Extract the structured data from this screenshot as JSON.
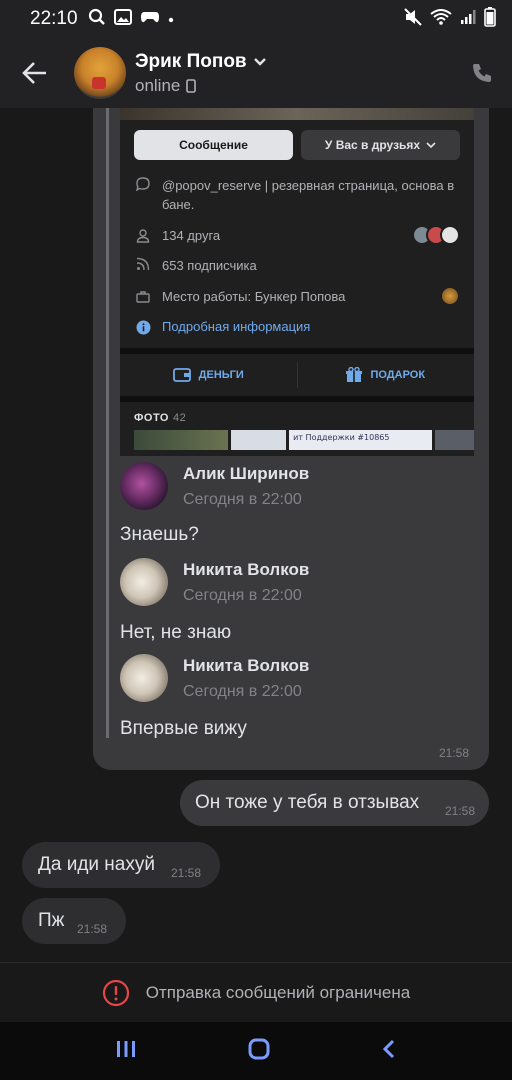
{
  "status_bar": {
    "time": "22:10"
  },
  "header": {
    "name": "Эрик Попов",
    "status": "online"
  },
  "profile_card": {
    "message_button": "Сообщение",
    "friends_button": "У Вас в друзьях",
    "status_line": "@popov_reserve | резервная страница, основа в бане.",
    "friends_count": "134 друга",
    "followers_count": "653 подписчика",
    "workplace": "Место работы: Бункер Попова",
    "details_link": "Подробная информация",
    "money_label": "ДЕНЬГИ",
    "gift_label": "ПОДАРОК",
    "photos_label": "ФОТО",
    "photos_count": "42",
    "photo_caption": "ит Поддержки #10865"
  },
  "forwarded_messages": [
    {
      "author": "Алик Ширинов",
      "time": "Сегодня в 22:00",
      "text": "Знаешь?"
    },
    {
      "author": "Никита Волков",
      "time": "Сегодня в 22:00",
      "text": "Нет, не знаю"
    },
    {
      "author": "Никита Волков",
      "time": "Сегодня в 22:00",
      "text": "Впервые вижу"
    }
  ],
  "forward_time": "21:58",
  "messages": [
    {
      "text": "Он тоже у тебя в отзывах",
      "time": "21:58",
      "direction": "out"
    },
    {
      "text": "Да иди нахуй",
      "time": "21:58",
      "direction": "in"
    },
    {
      "text": "Пж",
      "time": "21:58",
      "direction": "in"
    }
  ],
  "restriction_text": "Отправка сообщений ограничена",
  "colors": {
    "background": "#19191a",
    "header": "#222224",
    "link": "#71aaeb",
    "warning": "#e64646"
  }
}
